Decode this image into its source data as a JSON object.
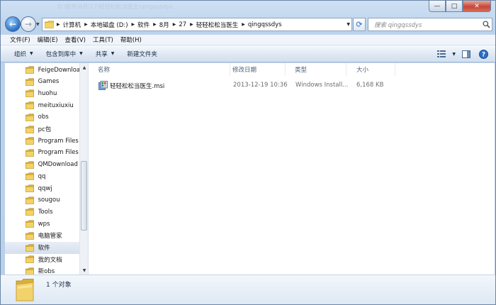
{
  "window": {
    "title": "D:\\软件\\8月\\27\\轻轻松松当医生\\qingqssdys",
    "controls": {
      "minimize": "—",
      "maximize": "□",
      "close": "✕"
    }
  },
  "address": {
    "crumbs": [
      "计算机",
      "本地磁盘 (D:)",
      "软件",
      "8月",
      "27",
      "轻轻松松当医生",
      "qingqssdys"
    ]
  },
  "search": {
    "placeholder": "搜索 qingqssdys"
  },
  "menu": [
    "文件(F)",
    "编辑(E)",
    "查看(V)",
    "工具(T)",
    "帮助(H)"
  ],
  "toolbar": [
    {
      "label": "组织",
      "dropdown": true
    },
    {
      "label": "包含到库中",
      "dropdown": true
    },
    {
      "label": "共享",
      "dropdown": true
    },
    {
      "label": "新建文件夹",
      "dropdown": false
    }
  ],
  "nav_tree": [
    {
      "label": "FeigeDownloa",
      "selected": false
    },
    {
      "label": "Games",
      "selected": false
    },
    {
      "label": "huohu",
      "selected": false
    },
    {
      "label": "meituxiuxiu",
      "selected": false
    },
    {
      "label": "obs",
      "selected": false
    },
    {
      "label": "pc包",
      "selected": false
    },
    {
      "label": "Program Files",
      "selected": false
    },
    {
      "label": "Program Files",
      "selected": false
    },
    {
      "label": "QMDownload",
      "selected": false
    },
    {
      "label": "qq",
      "selected": false
    },
    {
      "label": "qqwj",
      "selected": false
    },
    {
      "label": "sougou",
      "selected": false
    },
    {
      "label": "Tools",
      "selected": false
    },
    {
      "label": "wps",
      "selected": false
    },
    {
      "label": "电脑管家",
      "selected": false
    },
    {
      "label": "软件",
      "selected": true
    },
    {
      "label": "我的文档",
      "selected": false
    },
    {
      "label": "新obs",
      "selected": false
    }
  ],
  "columns": [
    "名称",
    "修改日期",
    "类型",
    "大小"
  ],
  "files": [
    {
      "name": "轻轻松松当医生.msi",
      "modified": "2013-12-19 10:36",
      "type": "Windows Install...",
      "size": "6,168 KB",
      "icon": "msi-installer-icon"
    }
  ],
  "status": {
    "count": "1 个对象"
  },
  "colors": {
    "folder": "#e8c34a",
    "accent": "#2b6fc2",
    "chrome": "#c6d9ee"
  }
}
